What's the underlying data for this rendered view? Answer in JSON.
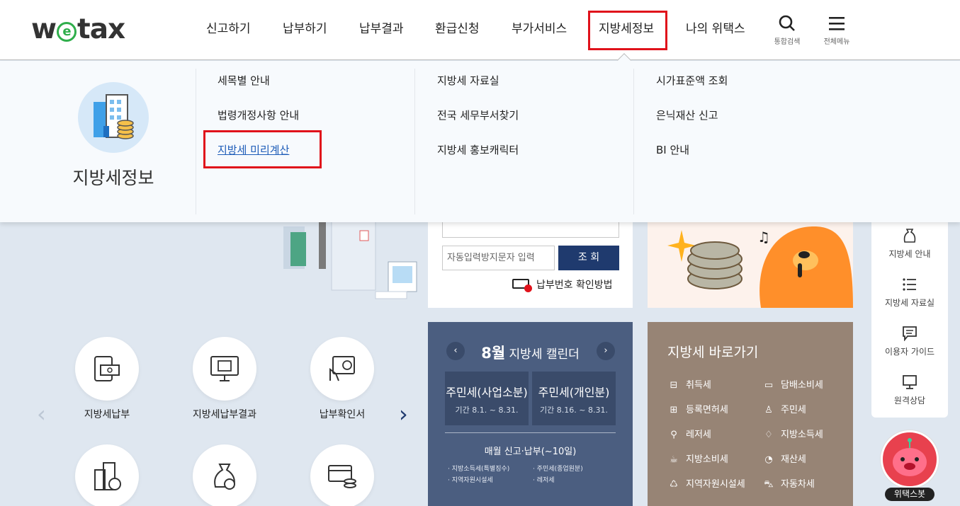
{
  "header": {
    "logo": "wetax",
    "nav": [
      "신고하기",
      "납부하기",
      "납부결과",
      "환급신청",
      "부가서비스",
      "지방세정보",
      "나의 위택스"
    ],
    "search_label": "통합검색",
    "menu_label": "전체메뉴"
  },
  "mega": {
    "title": "지방세정보",
    "col1": [
      "세목별 안내",
      "법령개정사항 안내",
      "지방세 미리계산"
    ],
    "col2": [
      "지방세 자료실",
      "전국 세무부서찾기",
      "지방세 홍보캐릭터"
    ],
    "col3": [
      "시가표준액 조회",
      "은닉재산 신고",
      "BI 안내"
    ]
  },
  "lookup": {
    "captcha_placeholder": "자동입력방지문자 입력",
    "search_button": "조 회",
    "guide_link": "납부번호 확인방법"
  },
  "calendar": {
    "month": "8월",
    "title": "지방세 캘린더",
    "boxes": [
      {
        "title": "주민세(사업소분)",
        "period": "기간 8.1. ~ 8.31."
      },
      {
        "title": "주민세(개인분)",
        "period": "기간 8.16. ~ 8.31."
      }
    ],
    "monthly_title": "매월 신고·납부(~10일)",
    "monthly_items": [
      "지방소득세(특별징수)",
      "주민세(종업원분)",
      "지역자원시설세",
      "레저세"
    ]
  },
  "shortcuts": {
    "title": "지방세 바로가기",
    "items": [
      "취득세",
      "담배소비세",
      "등록면허세",
      "주민세",
      "레저세",
      "지방소득세",
      "지방소비세",
      "재산세",
      "지역자원시설세",
      "자동차세"
    ]
  },
  "services": [
    "지방세납부",
    "지방세납부결과",
    "납부확인서"
  ],
  "quick": [
    "지방세 안내",
    "지방세 자료실",
    "이용자 가이드",
    "원격상담"
  ],
  "chatbot_label": "위택스봇",
  "colors": {
    "navy": "#1f3a6e",
    "highlight": "#e0121b",
    "calendar_bg": "#4b5e80",
    "shortcut_bg": "#978475",
    "brand_green": "#2fae4b"
  }
}
